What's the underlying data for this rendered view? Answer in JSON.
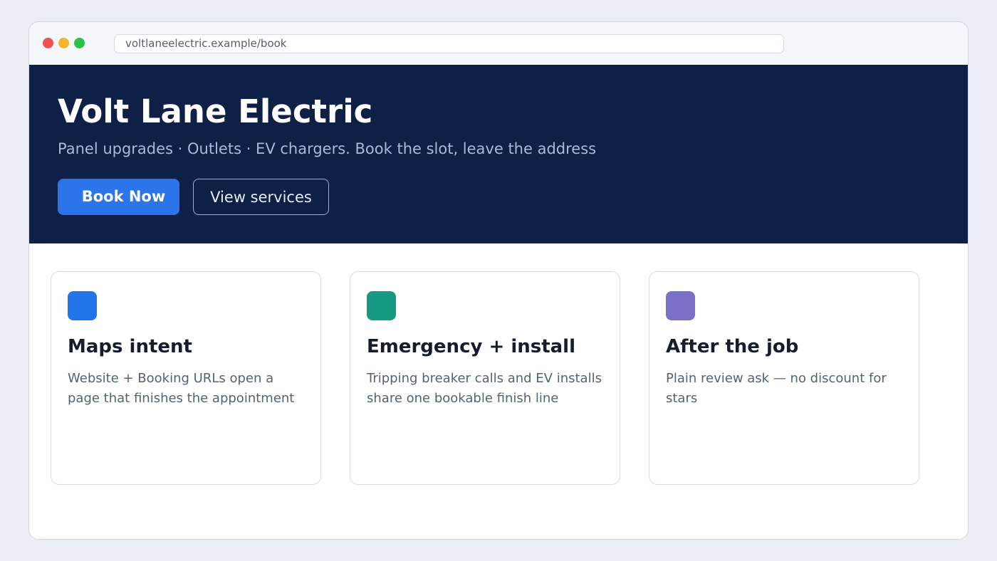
{
  "browser": {
    "url": "voltlaneelectric.example/book",
    "controls": {
      "close_color": "#f0524f",
      "minimize_color": "#f5b52d",
      "maximize_color": "#2bc04a"
    }
  },
  "hero": {
    "title": "Volt Lane Electric",
    "subtitle": "Panel upgrades · Outlets · EV chargers. Book the slot, leave the address",
    "primary_button": "Book Now",
    "secondary_button": "View services"
  },
  "cards": [
    {
      "title": "Maps intent",
      "description": "Website + Booking URLs open a page that finishes the appointment",
      "icon_color": "#2275e8"
    },
    {
      "title": "Emergency + install",
      "description": "Tripping breaker calls and EV installs share one bookable finish line",
      "icon_color": "#179a83"
    },
    {
      "title": "After the job",
      "description": "Plain review ask — no discount for stars",
      "icon_color": "#7b70c8"
    }
  ],
  "colors": {
    "hero_background": "#0f2047",
    "accent": "#2c74ea",
    "page_background": "#ebeef5"
  }
}
